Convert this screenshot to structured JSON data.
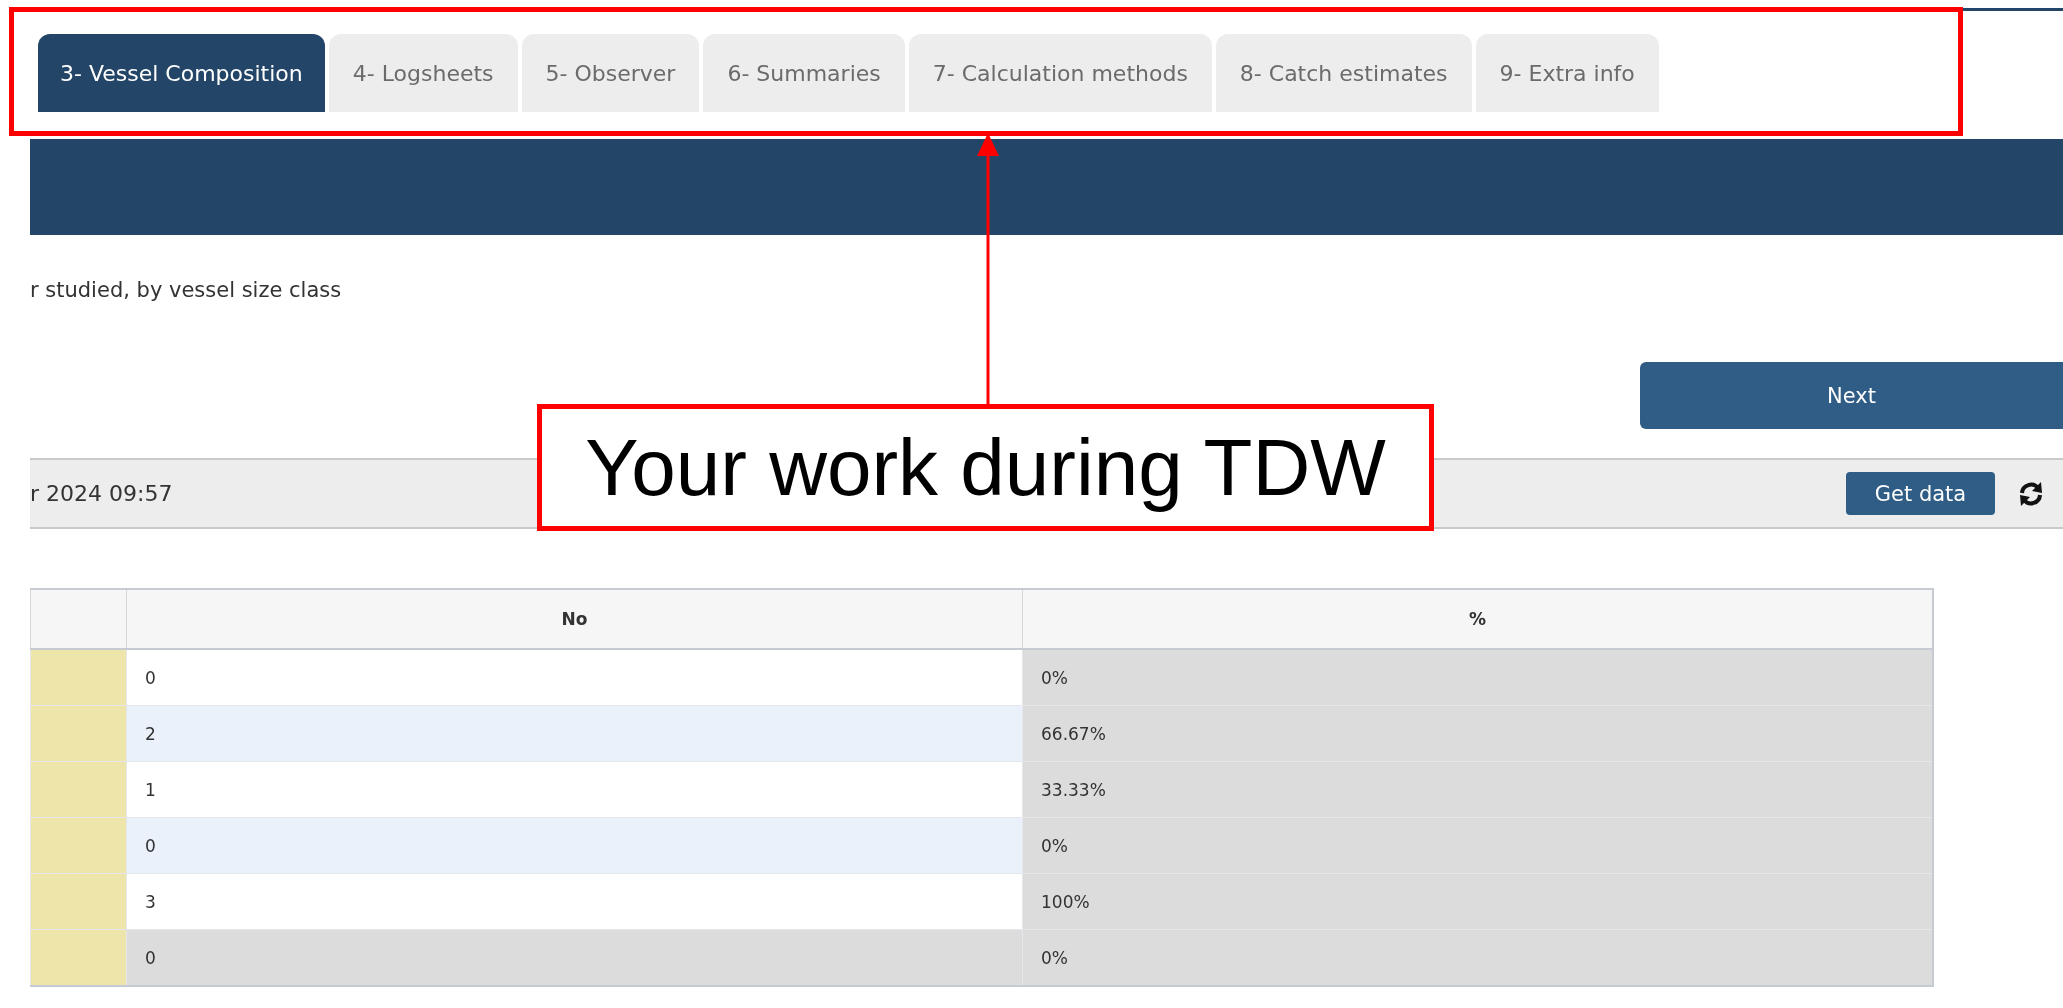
{
  "tabs": [
    {
      "label": "3- Vessel Composition",
      "selected": true
    },
    {
      "label": "4- Logsheets",
      "selected": false
    },
    {
      "label": "5- Observer",
      "selected": false
    },
    {
      "label": "6- Summaries",
      "selected": false
    },
    {
      "label": "7- Calculation methods",
      "selected": false
    },
    {
      "label": "8- Catch estimates",
      "selected": false
    },
    {
      "label": "9- Extra info",
      "selected": false
    }
  ],
  "description": "r studied, by vessel size class",
  "next_button": "Next",
  "data_bar": {
    "timestamp": "r 2024 09:57",
    "get_data_button": "Get data"
  },
  "table": {
    "columns": [
      "No",
      "%"
    ],
    "rows": [
      {
        "kind": "normal",
        "no": "0",
        "percent": "0%"
      },
      {
        "kind": "normal",
        "no": "2",
        "percent": "66.67%"
      },
      {
        "kind": "normal",
        "no": "1",
        "percent": "33.33%"
      },
      {
        "kind": "normal",
        "no": "0",
        "percent": "0%"
      },
      {
        "kind": "normal",
        "no": "3",
        "percent": "100%"
      },
      {
        "kind": "total",
        "no": "0",
        "percent": "0%"
      }
    ]
  },
  "annotation": {
    "callout": "Your work during TDW"
  }
}
